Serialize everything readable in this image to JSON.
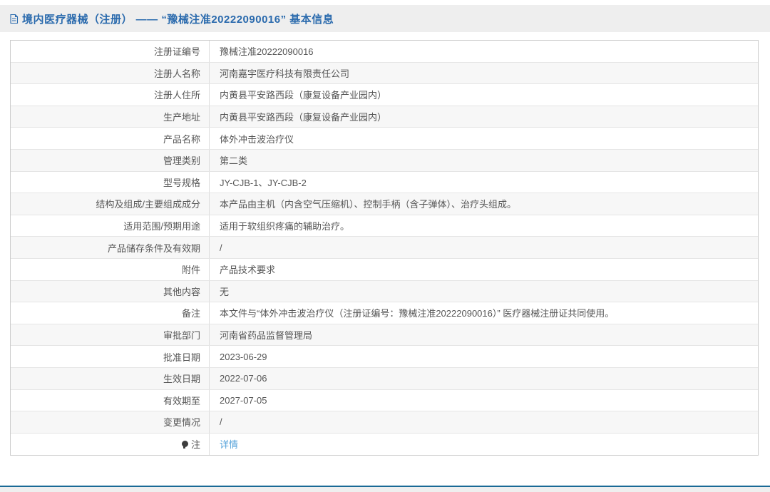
{
  "header": {
    "title": "境内医疗器械（注册） —— “豫械注准20222090016” 基本信息",
    "icon": "document-icon"
  },
  "table": {
    "rows": [
      {
        "label": "注册证编号",
        "value": "豫械注准20222090016"
      },
      {
        "label": "注册人名称",
        "value": "河南嘉宇医疗科技有限责任公司"
      },
      {
        "label": "注册人住所",
        "value": "内黄县平安路西段（康复设备产业园内）"
      },
      {
        "label": "生产地址",
        "value": "内黄县平安路西段（康复设备产业园内）"
      },
      {
        "label": "产品名称",
        "value": "体外冲击波治疗仪"
      },
      {
        "label": "管理类别",
        "value": "第二类"
      },
      {
        "label": "型号规格",
        "value": "JY-CJB-1、JY-CJB-2"
      },
      {
        "label": "结构及组成/主要组成成分",
        "value": "本产品由主机（内含空气压缩机）、控制手柄（含子弹体）、治疗头组成。"
      },
      {
        "label": "适用范围/预期用途",
        "value": "适用于软组织疼痛的辅助治疗。"
      },
      {
        "label": "产品储存条件及有效期",
        "value": "/"
      },
      {
        "label": "附件",
        "value": "产品技术要求"
      },
      {
        "label": "其他内容",
        "value": "无"
      },
      {
        "label": "备注",
        "value": "本文件与“体外冲击波治疗仪（注册证编号：豫械注准20222090016）” 医疗器械注册证共同使用。"
      },
      {
        "label": "审批部门",
        "value": "河南省药品监督管理局"
      },
      {
        "label": "批准日期",
        "value": "2023-06-29"
      },
      {
        "label": "生效日期",
        "value": "2022-07-06"
      },
      {
        "label": "有效期至",
        "value": "2027-07-05"
      },
      {
        "label": "变更情况",
        "value": "/"
      },
      {
        "label": "注",
        "label_icon": "bulb-icon",
        "value": "详情",
        "link": true
      }
    ]
  },
  "colors": {
    "title_blue": "#2a6aad",
    "link_blue": "#54a2da",
    "footer_line_teal": "#1a6a96",
    "bar_gray": "#eeeeee",
    "stripe_gray": "#f7f7f7"
  }
}
